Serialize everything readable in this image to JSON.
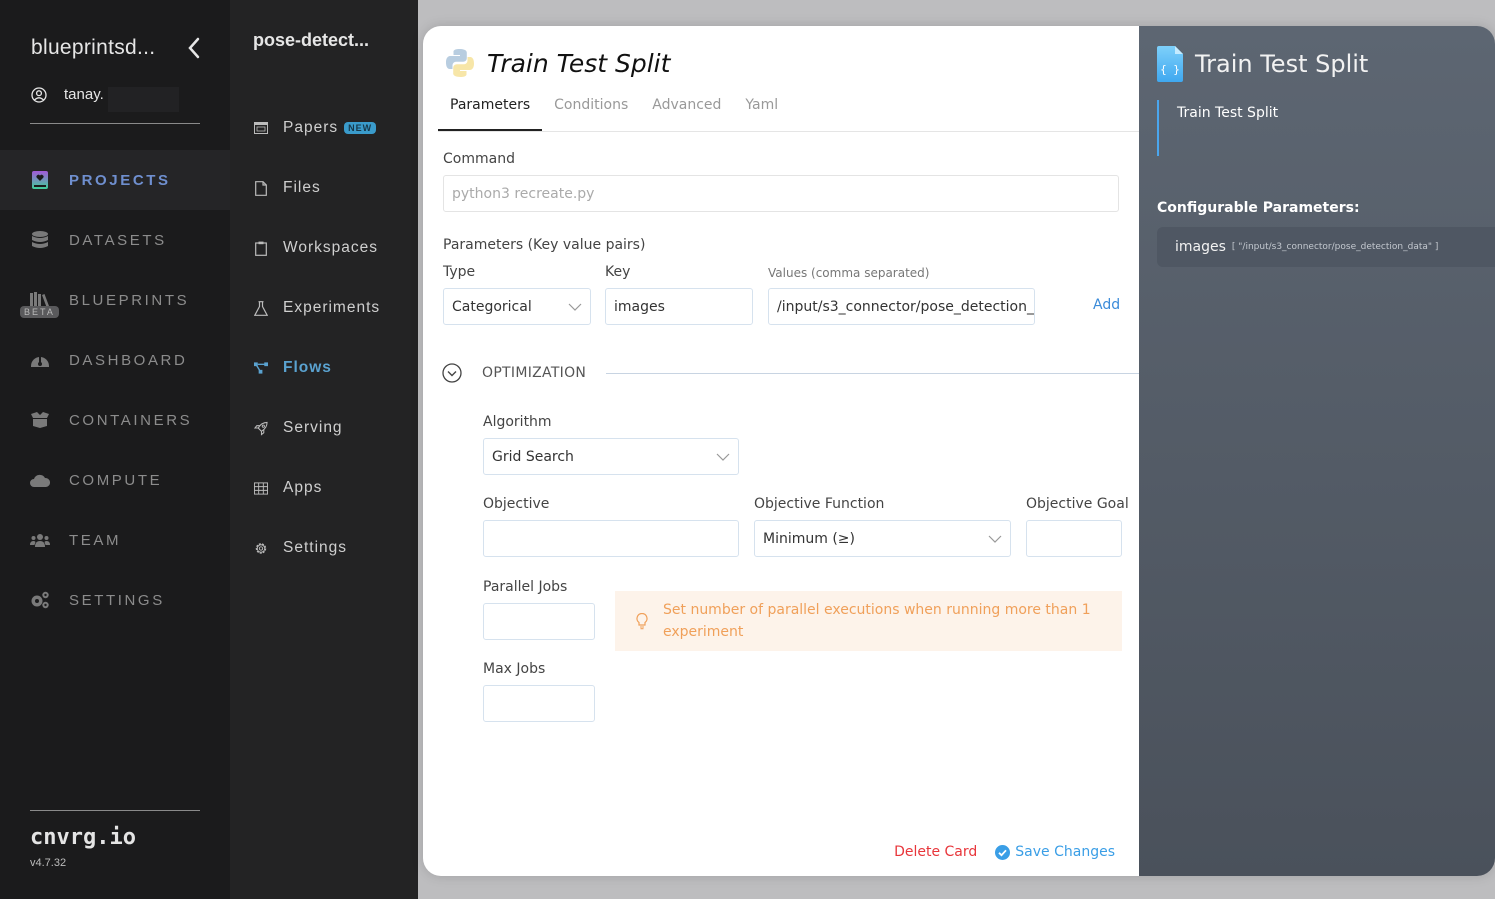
{
  "sidebar": {
    "org_name": "blueprintsd...",
    "user_name": "tanay.",
    "items": [
      {
        "label": "PROJECTS",
        "icon": "projects-book-icon",
        "active": true
      },
      {
        "label": "DATASETS",
        "icon": "database-icon"
      },
      {
        "label": "BLUEPRINTS",
        "icon": "books-icon",
        "badge": "BETA"
      },
      {
        "label": "DASHBOARD",
        "icon": "gauge-icon"
      },
      {
        "label": "CONTAINERS",
        "icon": "box-icon"
      },
      {
        "label": "COMPUTE",
        "icon": "cloud-icon"
      },
      {
        "label": "TEAM",
        "icon": "users-icon"
      },
      {
        "label": "SETTINGS",
        "icon": "gears-icon"
      }
    ],
    "brand": "cnvrg.io",
    "version": "v4.7.32",
    "active_color": "#6f8fcf"
  },
  "subbar": {
    "project_name": "pose-detect...",
    "items": [
      {
        "label": "Papers",
        "icon": "papers-icon",
        "badge": "NEW"
      },
      {
        "label": "Files",
        "icon": "file-icon"
      },
      {
        "label": "Workspaces",
        "icon": "clipboard-icon"
      },
      {
        "label": "Experiments",
        "icon": "flask-icon"
      },
      {
        "label": "Flows",
        "icon": "flows-icon",
        "active": true
      },
      {
        "label": "Serving",
        "icon": "rocket-icon"
      },
      {
        "label": "Apps",
        "icon": "grid-icon"
      },
      {
        "label": "Settings",
        "icon": "gear-icon"
      }
    ],
    "active_color": "#5aa2d0"
  },
  "card": {
    "title": "Train Test Split",
    "tabs": [
      "Parameters",
      "Conditions",
      "Advanced",
      "Yaml"
    ],
    "active_tab": "Parameters",
    "command": {
      "label": "Command",
      "placeholder": "python3 recreate.py",
      "value": ""
    },
    "params": {
      "section_label": "Parameters (Key value pairs)",
      "type_label": "Type",
      "type_value": "Categorical",
      "key_label": "Key",
      "key_value": "images",
      "values_label": "Values (comma separated)",
      "values_value": "/input/s3_connector/pose_detection_data",
      "add_label": "Add"
    },
    "optimization": {
      "title": "OPTIMIZATION",
      "algorithm_label": "Algorithm",
      "algorithm_value": "Grid Search",
      "objective_label": "Objective",
      "objective_value": "",
      "objective_function_label": "Objective Function",
      "objective_function_value": "Minimum (≥)",
      "objective_goal_label": "Objective Goal",
      "objective_goal_value": "",
      "parallel_jobs_label": "Parallel Jobs",
      "parallel_jobs_value": "",
      "max_jobs_label": "Max Jobs",
      "max_jobs_value": "",
      "hint": "Set number of parallel executions when running more than 1 experiment"
    },
    "actions": {
      "delete": "Delete Card",
      "save": "Save Changes"
    },
    "colors": {
      "delete": "#e8363b",
      "save": "#3a9ee6",
      "hint_text": "#f0a05a",
      "hint_bg": "#fdf3ea"
    }
  },
  "side_panel": {
    "title": "Train Test Split",
    "description": "Train Test Split",
    "config_title": "Configurable Parameters:",
    "params": [
      {
        "key": "images",
        "value": "[ \"/input/s3_connector/pose_detection_data\" ]"
      }
    ]
  }
}
